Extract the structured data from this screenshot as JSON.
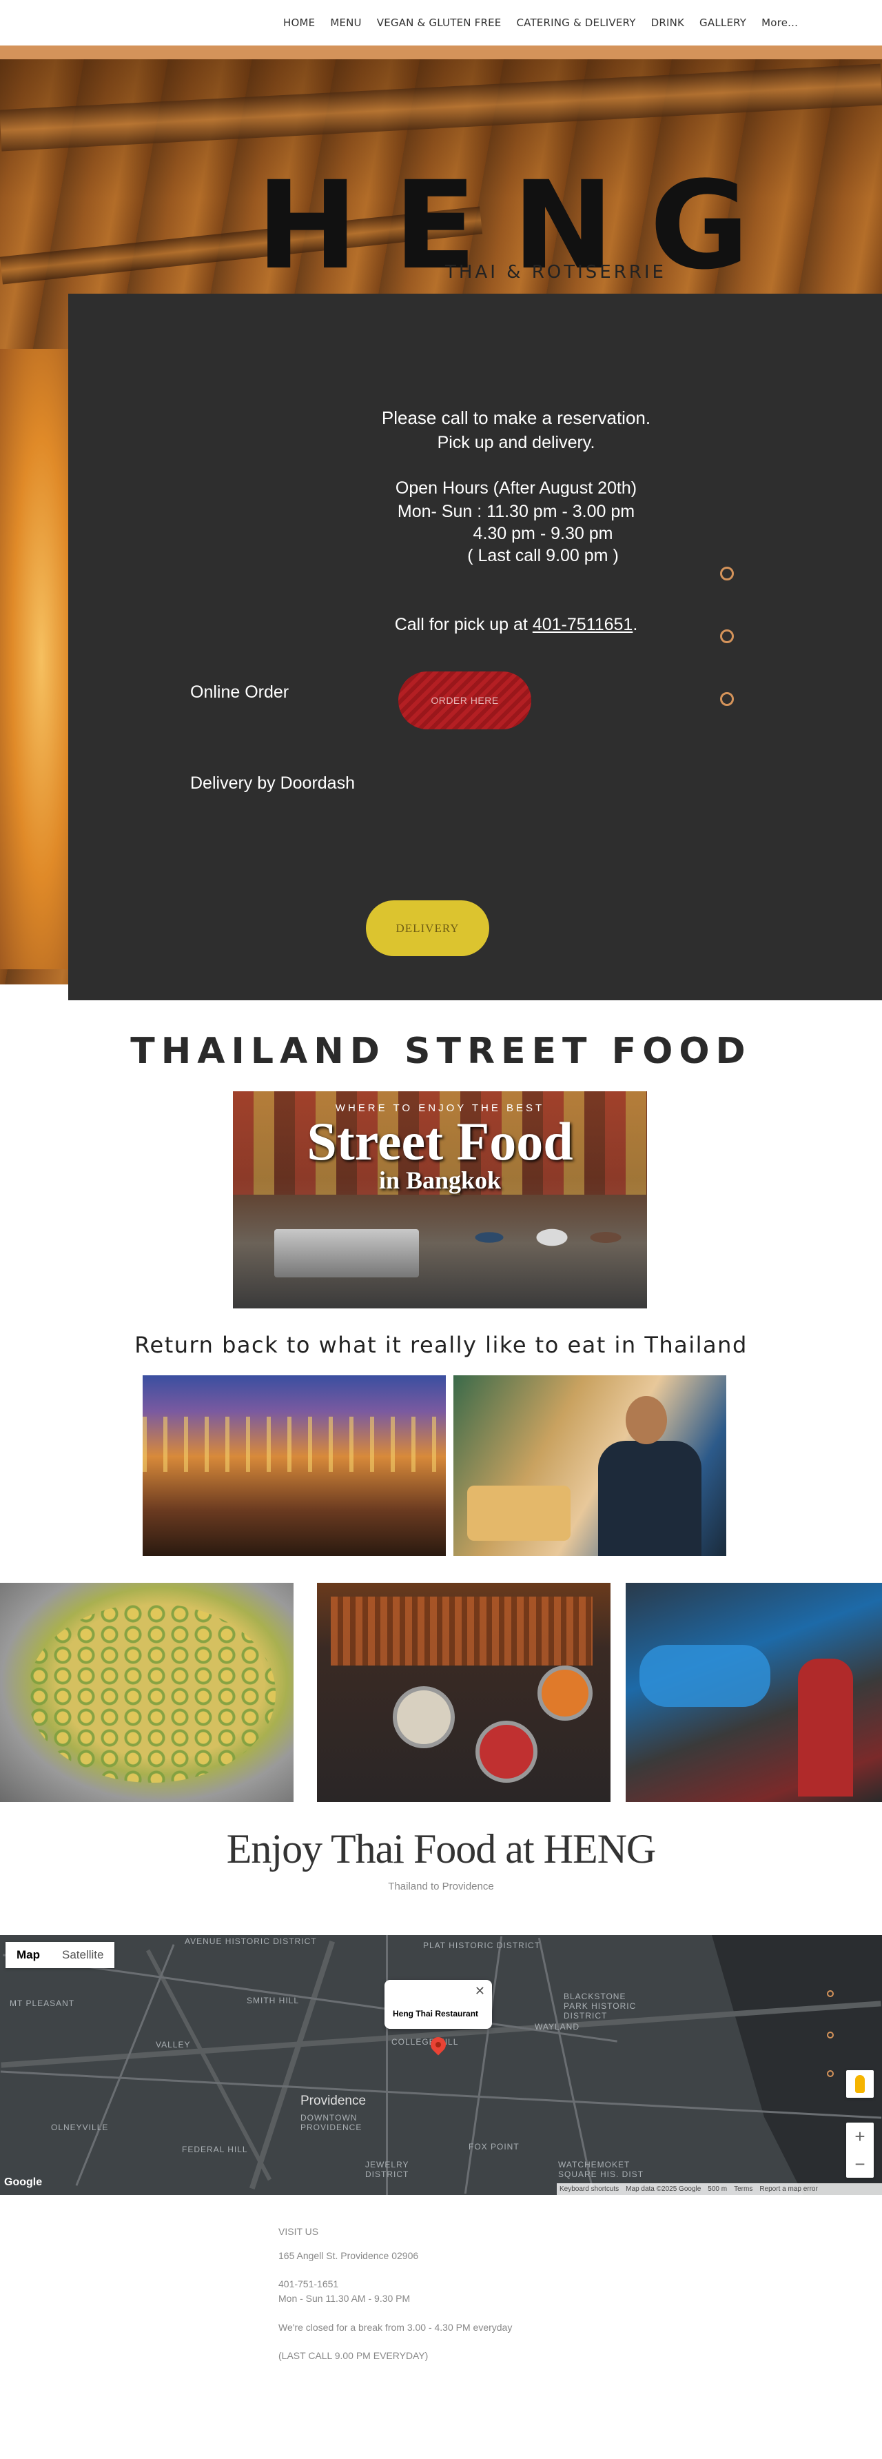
{
  "nav": {
    "items": [
      "HOME",
      "MENU",
      "VEGAN & GLUTEN FREE",
      "CATERING & DELIVERY",
      "DRINK",
      "GALLERY",
      "More..."
    ]
  },
  "hero": {
    "logo": "HENG",
    "logo_sub": "THAI & ROTISERRIE",
    "reservation": "Please call to make a reservation.",
    "pickup": "Pick up and delivery.",
    "hours_title": "Open Hours (After August 20th)",
    "hours_1": "Mon- Sun : 11.30 pm - 3.00 pm",
    "hours_2": "4.30 pm - 9.30 pm",
    "hours_3": "( Last call 9.00 pm )",
    "call_prefix": "Call for pick up at ",
    "phone": "401-7511651",
    "call_suffix": ".",
    "online_label": "Online Order",
    "order_button": "ORDER HERE",
    "doordash_label": "Delivery by Doordash",
    "delivery_button": "DELIVERY"
  },
  "street_food": {
    "title": "THAILAND STREET FOOD",
    "banner_where": "WHERE TO ENJOY THE BEST",
    "banner_big": "Street Food",
    "banner_small": "in Bangkok",
    "return_title": "Return back to what it really like to eat in Thailand"
  },
  "enjoy": {
    "title": "Enjoy Thai Food at HENG",
    "subtitle": "Thailand to Providence"
  },
  "map": {
    "map_button": "Map",
    "satellite_button": "Satellite",
    "info_title": "Heng Thai Restaurant",
    "google": "Google",
    "footer": [
      "Keyboard shortcuts",
      "Map data ©2025 Google",
      "500 m",
      "Terms",
      "Report a map error"
    ],
    "labels": {
      "providence": "Providence",
      "downtown": "DOWNTOWN PROVIDENCE",
      "mt_pleasant": "MT PLEASANT",
      "smith_hill": "SMITH HILL",
      "valley": "VALLEY",
      "olneyville": "OLNEYVILLE",
      "federal_hill": "FEDERAL HILL",
      "jewelry": "JEWELRY DISTRICT",
      "fox_point": "FOX POINT",
      "wayland": "WAYLAND",
      "blackstone": "BLACKSTONE PARK HISTORIC DISTRICT",
      "college_hill": "COLLEGE HILL",
      "plat": "PLAT HISTORIC DISTRICT",
      "avenue": "AVENUE HISTORIC DISTRICT",
      "watchemoket": "WATCHEMOKET SQUARE HIS. DIST"
    }
  },
  "footer": {
    "visit": "VISIT US",
    "address": "165 Angell St. Providence 02906",
    "phone": "401-751-1651",
    "hours": "Mon - Sun  11.30 AM - 9.30 PM",
    "closed": "We're closed for a break from 3.00 - 4.30 PM everyday",
    "last_call": "(LAST CALL 9.00 PM EVERYDAY)"
  },
  "colors": {
    "accent": "#d4935a",
    "panel": "#2e2e2e",
    "order_button": "#b41f23",
    "delivery_button": "#dcc42f"
  }
}
